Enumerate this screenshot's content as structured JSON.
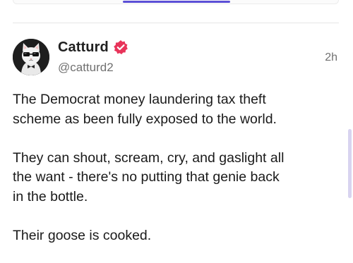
{
  "post": {
    "author": {
      "display_name": "Catturd",
      "handle": "@catturd2",
      "verified": true,
      "avatar_icon": "cat-with-glasses-avatar"
    },
    "timestamp": "2h",
    "body_lines": [
      [
        "The Democrat money laundering tax theft",
        "scheme as been fully exposed to the world."
      ],
      [
        "They can shout, scream, cry, and gaslight all",
        "the want - there's no putting that genie back",
        "in the bottle."
      ],
      [
        "Their goose is cooked."
      ]
    ]
  },
  "colors": {
    "accent": "#5b4fd6",
    "verified_badge": "#e8345a",
    "muted_text": "#707070",
    "scrollbar": "#d8d4f0"
  },
  "icons": {
    "verified": "verified-badge-icon"
  }
}
